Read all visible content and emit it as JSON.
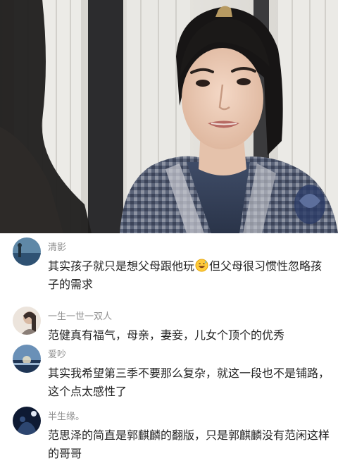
{
  "video_frame": {
    "description_icon": "drama-still"
  },
  "comments": [
    {
      "username": "清影",
      "text_before": "其实孩子就只是想父母跟他玩",
      "emoji": "grinning-sweat-emoji",
      "text_after": "但父母很习惯性忽略孩子的需求"
    },
    {
      "username": "一生一世一双人",
      "text": "范健真有福气，母亲，妻妾，儿女个顶个的优秀"
    },
    {
      "username": "爱吵",
      "text": "其实我希望第三季不要那么复杂，就这一段也不是铺路，这个点太感性了"
    },
    {
      "username": "半生缘。",
      "text": "范思泽的简直是郭麒麟的翻版，只是郭麒麟没有范闲这样的哥哥"
    }
  ],
  "colors": {
    "username": "#8f8f8f",
    "text": "#222222",
    "background": "#ffffff"
  }
}
